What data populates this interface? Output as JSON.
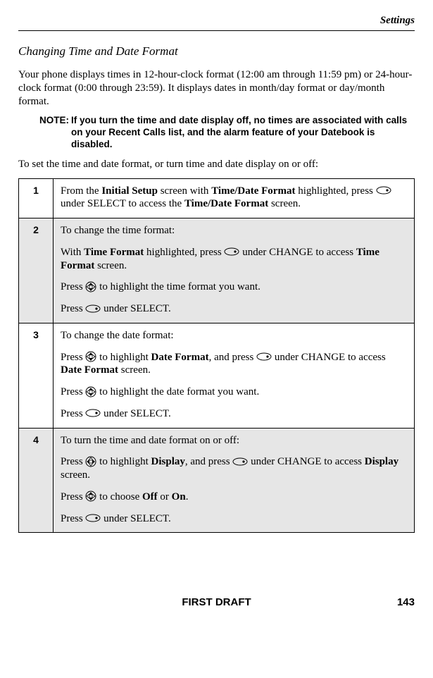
{
  "header": {
    "section": "Settings"
  },
  "subheading": "Changing Time and Date Format",
  "intro": "Your phone displays times in 12-hour-clock format (12:00 am through 11:59 pm) or 24-hour-clock format (0:00 through 23:59). It displays dates in month/day format or day/month format.",
  "note": {
    "label": "NOTE:",
    "text": "If you turn the time and date display off, no times are associated with calls on your Recent Calls list, and the alarm feature of your Datebook is disabled."
  },
  "instruction": "To set the time and date format, or turn time and date display on or off:",
  "steps": [
    {
      "num": "1",
      "shaded": false,
      "segments": [
        [
          {
            "t": "From the "
          },
          {
            "t": "Initial Setup",
            "b": true
          },
          {
            "t": " screen with "
          },
          {
            "t": "Time/Date Format",
            "b": true
          },
          {
            "t": " highlighted, press "
          },
          {
            "icon": "soft-right"
          },
          {
            "t": " under SELECT to access the "
          },
          {
            "t": "Time/Date Format",
            "b": true
          },
          {
            "t": " screen."
          }
        ]
      ]
    },
    {
      "num": "2",
      "shaded": true,
      "segments": [
        [
          {
            "t": "To change the time format:"
          }
        ],
        [
          {
            "t": "With "
          },
          {
            "t": "Time Format",
            "b": true
          },
          {
            "t": " highlighted, press "
          },
          {
            "icon": "soft-right"
          },
          {
            "t": " under CHANGE to access "
          },
          {
            "t": "Time Format",
            "b": true
          },
          {
            "t": " screen."
          }
        ],
        [
          {
            "t": "Press "
          },
          {
            "icon": "nav-vert"
          },
          {
            "t": " to highlight the time format you want."
          }
        ],
        [
          {
            "t": "Press "
          },
          {
            "icon": "soft-right"
          },
          {
            "t": " under SELECT."
          }
        ]
      ]
    },
    {
      "num": "3",
      "shaded": false,
      "segments": [
        [
          {
            "t": "To change the date format:"
          }
        ],
        [
          {
            "t": "Press "
          },
          {
            "icon": "nav-vert"
          },
          {
            "t": " to highlight "
          },
          {
            "t": "Date Format",
            "b": true
          },
          {
            "t": ", and press "
          },
          {
            "icon": "soft-right"
          },
          {
            "t": " under CHANGE to access "
          },
          {
            "t": "Date Format",
            "b": true
          },
          {
            "t": " screen."
          }
        ],
        [
          {
            "t": "Press "
          },
          {
            "icon": "nav-vert"
          },
          {
            "t": " to highlight the date format you want."
          }
        ],
        [
          {
            "t": "Press "
          },
          {
            "icon": "soft-right"
          },
          {
            "t": " under SELECT."
          }
        ]
      ]
    },
    {
      "num": "4",
      "shaded": true,
      "segments": [
        [
          {
            "t": "To turn the time and date format on or off:"
          }
        ],
        [
          {
            "t": "Press "
          },
          {
            "icon": "nav-horiz"
          },
          {
            "t": " to highlight "
          },
          {
            "t": "Display",
            "b": true
          },
          {
            "t": ", and press "
          },
          {
            "icon": "soft-right"
          },
          {
            "t": " under CHANGE to access "
          },
          {
            "t": "Display",
            "b": true
          },
          {
            "t": " screen."
          }
        ],
        [
          {
            "t": "Press "
          },
          {
            "icon": "nav-vert"
          },
          {
            "t": " to choose "
          },
          {
            "t": "Off",
            "b": true
          },
          {
            "t": " or "
          },
          {
            "t": "On",
            "b": true
          },
          {
            "t": "."
          }
        ],
        [
          {
            "t": "Press "
          },
          {
            "icon": "soft-right"
          },
          {
            "t": " under SELECT."
          }
        ]
      ]
    }
  ],
  "footer": {
    "draft": "FIRST DRAFT",
    "page": "143"
  }
}
